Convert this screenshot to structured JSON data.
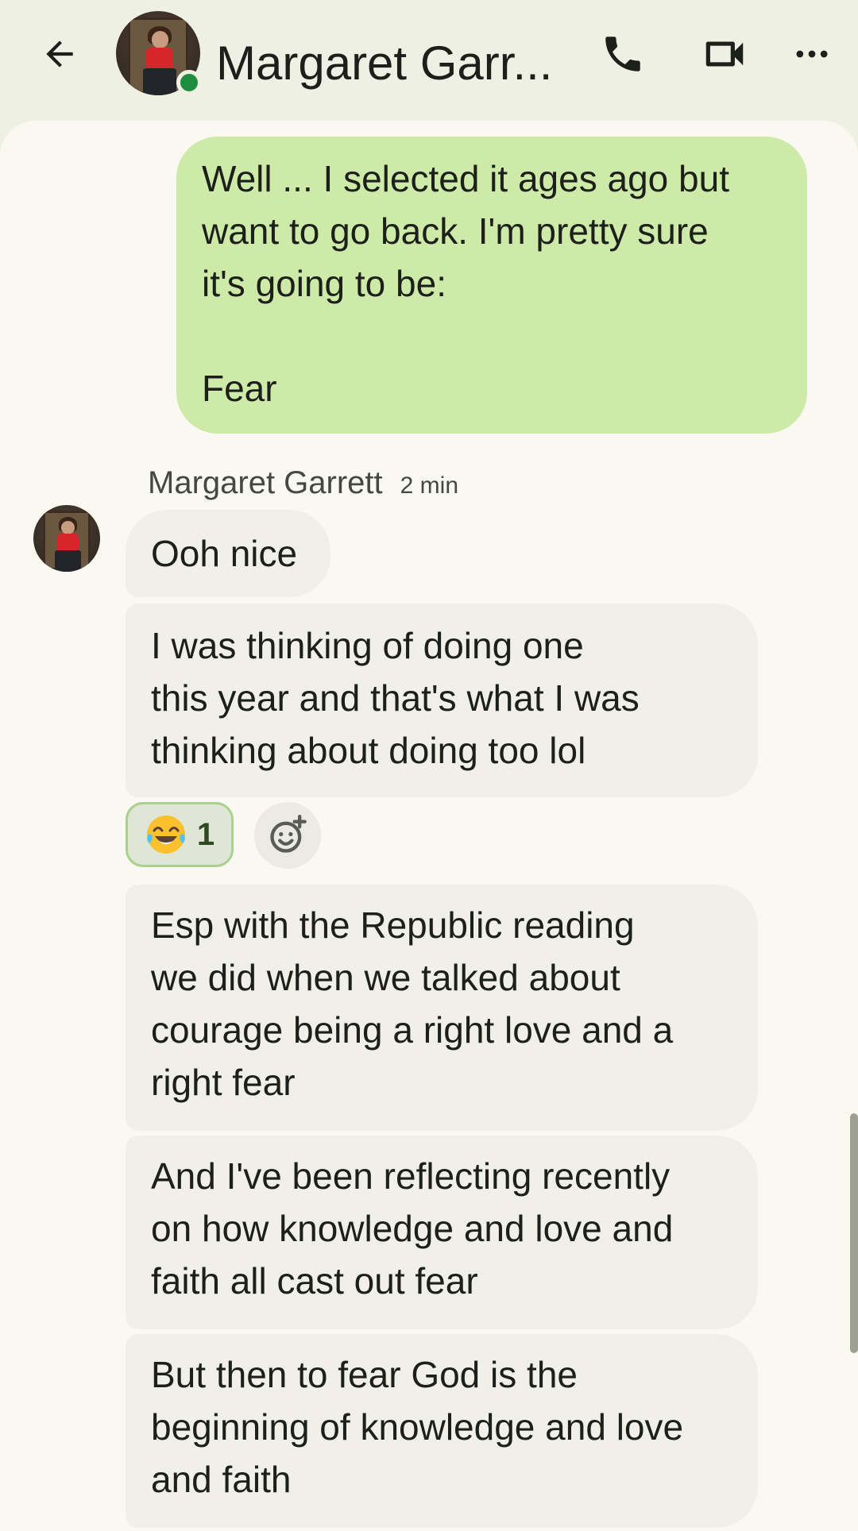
{
  "header": {
    "contact_name": "Margaret Garr...",
    "back_icon": "arrow-back-icon",
    "call_icon": "phone-icon",
    "video_icon": "videocam-icon",
    "more_icon": "more-horizontal-icon",
    "online_status_color": "#1e8e3e"
  },
  "messages": {
    "outgoing_1": "Well ... I selected it ages ago but\nwant to go back. I'm pretty sure\nit's going to be:\n\nFear",
    "sender_name": "Margaret Garrett",
    "sender_time": "2 min",
    "incoming_1": "Ooh nice",
    "incoming_2": "I was thinking of doing one\nthis year and that's what I was\nthinking about doing too lol",
    "incoming_3": "Esp with the Republic reading\nwe did when we talked about\ncourage being a right love and a\nright fear",
    "incoming_4": "And I've been reflecting recently\non how knowledge and love and\nfaith all cast out fear",
    "incoming_5": "But then to fear God is the\nbeginning of knowledge and love\nand faith"
  },
  "reaction": {
    "emoji": "face-with-tears-of-joy",
    "count": "1",
    "add_icon": "add-reaction-icon"
  },
  "colors": {
    "outgoing_bubble": "#cdeaa8",
    "incoming_bubble": "#f0f0e9",
    "header_bg": "#eef0e4",
    "conversation_bg": "#f9f9f2"
  }
}
